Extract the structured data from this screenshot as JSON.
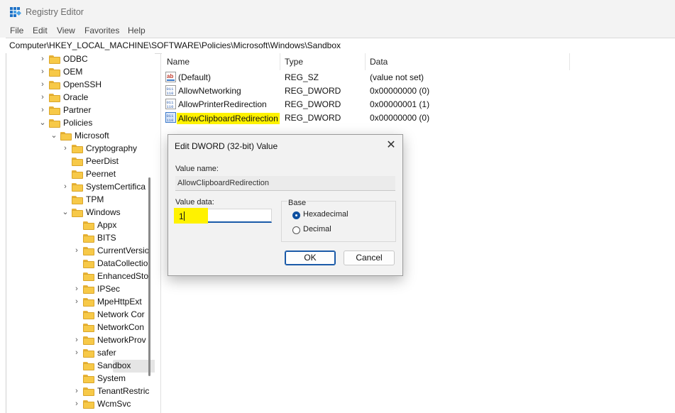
{
  "window": {
    "title": "Registry Editor"
  },
  "menu": [
    "File",
    "Edit",
    "View",
    "Favorites",
    "Help"
  ],
  "address": "Computer\\HKEY_LOCAL_MACHINE\\SOFTWARE\\Policies\\Microsoft\\Windows\\Sandbox",
  "tree": [
    {
      "label": "ODBC",
      "expander": "›"
    },
    {
      "label": "OEM",
      "expander": "›"
    },
    {
      "label": "OpenSSH",
      "expander": "›"
    },
    {
      "label": "Oracle",
      "expander": "›"
    },
    {
      "label": "Partner",
      "expander": "›"
    },
    {
      "label": "Policies",
      "expander": "⌄"
    },
    {
      "label": "Microsoft",
      "expander": "⌄"
    },
    {
      "label": "Cryptography",
      "expander": "›"
    },
    {
      "label": "PeerDist",
      "expander": ""
    },
    {
      "label": "Peernet",
      "expander": ""
    },
    {
      "label": "SystemCertifica",
      "expander": "›"
    },
    {
      "label": "TPM",
      "expander": ""
    },
    {
      "label": "Windows",
      "expander": "⌄"
    },
    {
      "label": "Appx",
      "expander": ""
    },
    {
      "label": "BITS",
      "expander": ""
    },
    {
      "label": "CurrentVersio",
      "expander": "›"
    },
    {
      "label": "DataCollectio",
      "expander": ""
    },
    {
      "label": "EnhancedSto",
      "expander": ""
    },
    {
      "label": "IPSec",
      "expander": "›"
    },
    {
      "label": "MpeHttpExt",
      "expander": "›"
    },
    {
      "label": "Network Cor",
      "expander": ""
    },
    {
      "label": "NetworkCon",
      "expander": ""
    },
    {
      "label": "NetworkProv",
      "expander": "›"
    },
    {
      "label": "safer",
      "expander": "›"
    },
    {
      "label": "Sandbox",
      "expander": "",
      "selected": true
    },
    {
      "label": "System",
      "expander": ""
    },
    {
      "label": "TenantRestric",
      "expander": "›"
    },
    {
      "label": "WcmSvc",
      "expander": "›"
    }
  ],
  "columns": {
    "name": "Name",
    "type": "Type",
    "data": "Data"
  },
  "values": [
    {
      "name": "(Default)",
      "type": "REG_SZ",
      "data": "(value not set)",
      "icon": "string-value-icon"
    },
    {
      "name": "AllowNetworking",
      "type": "REG_DWORD",
      "data": "0x00000000 (0)",
      "icon": "dword-value-icon"
    },
    {
      "name": "AllowPrinterRedirection",
      "type": "REG_DWORD",
      "data": "0x00000001 (1)",
      "icon": "dword-value-icon"
    },
    {
      "name": "AllowClipboardRedirection",
      "type": "REG_DWORD",
      "data": "0x00000000 (0)",
      "icon": "dword-value-icon",
      "highlighted": true
    }
  ],
  "dialog": {
    "title": "Edit DWORD (32-bit) Value",
    "value_name_label": "Value name:",
    "value_name": "AllowClipboardRedirection",
    "value_data_label": "Value data:",
    "value_data": "1",
    "base_label": "Base",
    "base_options": [
      "Hexadecimal",
      "Decimal"
    ],
    "base_selected": "Hexadecimal",
    "ok_label": "OK",
    "cancel_label": "Cancel",
    "close_glyph": "✕"
  },
  "colors": {
    "highlight": "#fff200",
    "accent": "#1a5aa8",
    "folder": "#f7c948"
  }
}
